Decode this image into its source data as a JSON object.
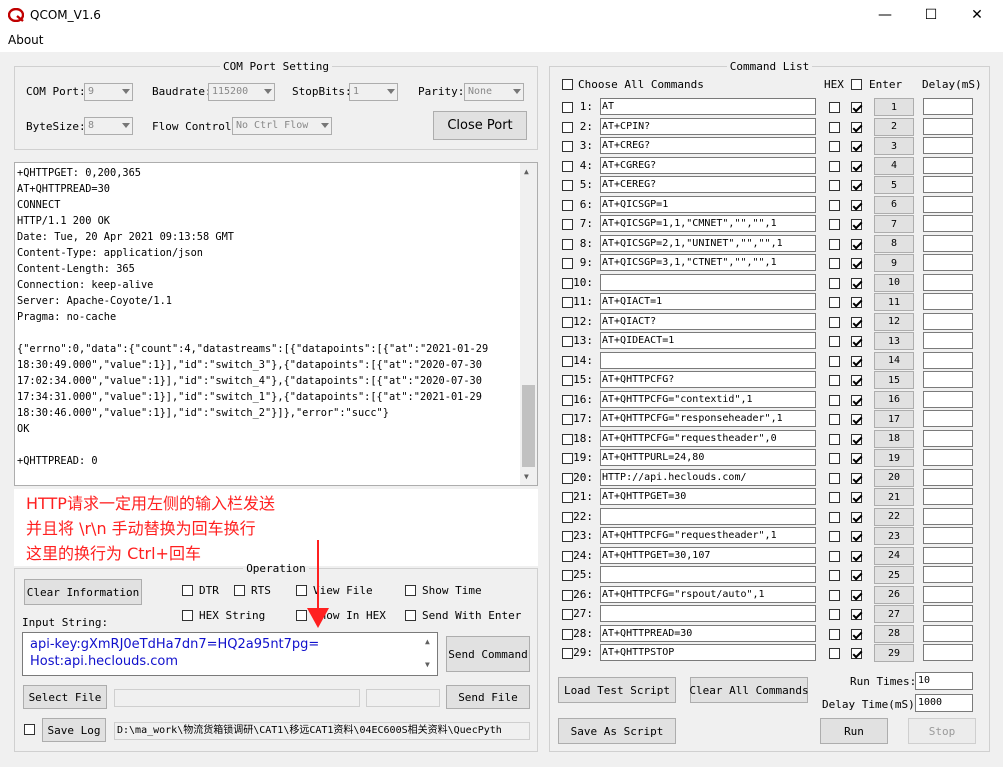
{
  "window": {
    "title": "QCOM_V1.6",
    "minimize": "—",
    "maximize": "☐",
    "close": "✕"
  },
  "menu": {
    "about": "About"
  },
  "com_setting": {
    "legend": "COM Port Setting",
    "com_port_label": "COM Port:",
    "com_port_value": "9",
    "baudrate_label": "Baudrate:",
    "baudrate_value": "115200",
    "stopbits_label": "StopBits:",
    "stopbits_value": "1",
    "parity_label": "Parity:",
    "parity_value": "None",
    "bytesize_label": "ByteSize:",
    "bytesize_value": "8",
    "flow_label": "Flow Control:",
    "flow_value": "No Ctrl Flow",
    "close_port": "Close Port"
  },
  "receive_text": "+QHTTPGET: 0,200,365\nAT+QHTTPREAD=30\nCONNECT\nHTTP/1.1 200 OK\nDate: Tue, 20 Apr 2021 09:13:58 GMT\nContent-Type: application/json\nContent-Length: 365\nConnection: keep-alive\nServer: Apache-Coyote/1.1\nPragma: no-cache\n\n{\"errno\":0,\"data\":{\"count\":4,\"datastreams\":[{\"datapoints\":[{\"at\":\"2021-01-29\n18:30:49.000\",\"value\":1}],\"id\":\"switch_3\"},{\"datapoints\":[{\"at\":\"2020-07-30\n17:02:34.000\",\"value\":1}],\"id\":\"switch_4\"},{\"datapoints\":[{\"at\":\"2020-07-30\n17:34:31.000\",\"value\":1}],\"id\":\"switch_1\"},{\"datapoints\":[{\"at\":\"2021-01-29\n18:30:46.000\",\"value\":1}],\"id\":\"switch_2\"}]},\"error\":\"succ\"}\nOK\n\n+QHTTPREAD: 0",
  "annotation": {
    "line1": "HTTP请求一定用左侧的输入栏发送",
    "line2": "并且将 \\r\\n 手动替换为回车换行",
    "line3": "这里的换行为 Ctrl+回车"
  },
  "operation": {
    "legend": "Operation",
    "clear_info": "Clear Information",
    "dtr": "DTR",
    "rts": "RTS",
    "view_file": "View File",
    "show_time": "Show Time",
    "hex_string": "HEX String",
    "show_in_hex": "Show In HEX",
    "send_with_enter": "Send With Enter",
    "input_label": "Input String:",
    "input_value": "api-key:gXmRJ0eTdHa7dn7=HQ2a95nt7pg=\nHost:api.heclouds.com",
    "send_command": "Send Command",
    "select_file": "Select File",
    "send_file": "Send File",
    "save_log": "Save Log",
    "log_path": "D:\\ma_work\\物流货箱锁调研\\CAT1\\移远CAT1资料\\04EC600S相关资料\\QuecPyth"
  },
  "commands": {
    "legend": "Command List",
    "choose_all": "Choose All Commands",
    "hex_header": "HEX",
    "enter_header": "Enter",
    "delay_header": "Delay(mS)",
    "rows": [
      {
        "num": "1:",
        "cmd": "AT",
        "btn": "1"
      },
      {
        "num": "2:",
        "cmd": "AT+CPIN?",
        "btn": "2"
      },
      {
        "num": "3:",
        "cmd": "AT+CREG?",
        "btn": "3"
      },
      {
        "num": "4:",
        "cmd": "AT+CGREG?",
        "btn": "4"
      },
      {
        "num": "5:",
        "cmd": "AT+CEREG?",
        "btn": "5"
      },
      {
        "num": "6:",
        "cmd": "AT+QICSGP=1",
        "btn": "6"
      },
      {
        "num": "7:",
        "cmd": "AT+QICSGP=1,1,\"CMNET\",\"\",\"\",1",
        "btn": "7"
      },
      {
        "num": "8:",
        "cmd": "AT+QICSGP=2,1,\"UNINET\",\"\",\"\",1",
        "btn": "8"
      },
      {
        "num": "9:",
        "cmd": "AT+QICSGP=3,1,\"CTNET\",\"\",\"\",1",
        "btn": "9"
      },
      {
        "num": "10:",
        "cmd": "",
        "btn": "10"
      },
      {
        "num": "11:",
        "cmd": "AT+QIACT=1",
        "btn": "11"
      },
      {
        "num": "12:",
        "cmd": "AT+QIACT?",
        "btn": "12"
      },
      {
        "num": "13:",
        "cmd": "AT+QIDEACT=1",
        "btn": "13"
      },
      {
        "num": "14:",
        "cmd": "",
        "btn": "14"
      },
      {
        "num": "15:",
        "cmd": "AT+QHTTPCFG?",
        "btn": "15"
      },
      {
        "num": "16:",
        "cmd": "AT+QHTTPCFG=\"contextid\",1",
        "btn": "16"
      },
      {
        "num": "17:",
        "cmd": "AT+QHTTPCFG=\"responseheader\",1",
        "btn": "17"
      },
      {
        "num": "18:",
        "cmd": "AT+QHTTPCFG=\"requestheader\",0",
        "btn": "18"
      },
      {
        "num": "19:",
        "cmd": "AT+QHTTPURL=24,80",
        "btn": "19"
      },
      {
        "num": "20:",
        "cmd": "HTTP://api.heclouds.com/",
        "btn": "20"
      },
      {
        "num": "21:",
        "cmd": "AT+QHTTPGET=30",
        "btn": "21"
      },
      {
        "num": "22:",
        "cmd": "",
        "btn": "22"
      },
      {
        "num": "23:",
        "cmd": "AT+QHTTPCFG=\"requestheader\",1",
        "btn": "23"
      },
      {
        "num": "24:",
        "cmd": "AT+QHTTPGET=30,107",
        "btn": "24"
      },
      {
        "num": "25:",
        "cmd": "",
        "btn": "25"
      },
      {
        "num": "26:",
        "cmd": "AT+QHTTPCFG=\"rspout/auto\",1",
        "btn": "26"
      },
      {
        "num": "27:",
        "cmd": "",
        "btn": "27"
      },
      {
        "num": "28:",
        "cmd": "AT+QHTTPREAD=30",
        "btn": "28"
      },
      {
        "num": "29:",
        "cmd": "AT+QHTTPSTOP",
        "btn": "29"
      }
    ],
    "load_script": "Load Test Script",
    "clear_all": "Clear All Commands",
    "save_script": "Save As Script",
    "run_times_label": "Run Times:",
    "run_times_value": "10",
    "delay_time_label": "Delay Time(mS):",
    "delay_time_value": "1000",
    "run": "Run",
    "stop": "Stop"
  }
}
